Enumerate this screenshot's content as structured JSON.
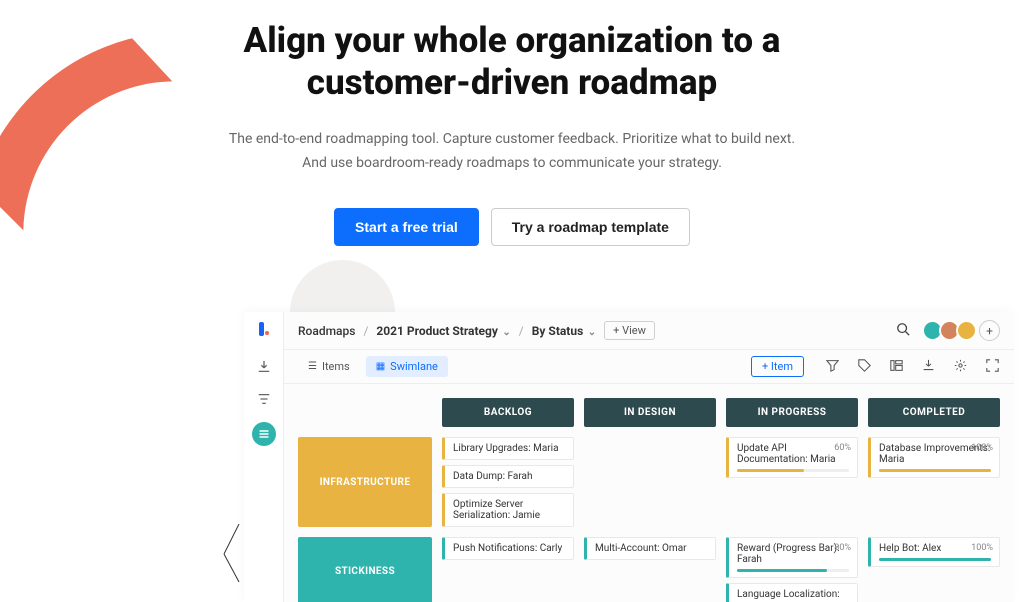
{
  "hero": {
    "title_line1": "Align your whole organization to a",
    "title_line2": "customer-driven roadmap",
    "subtitle_line1": "The end-to-end roadmapping tool. Capture customer feedback. Prioritize what to build next.",
    "subtitle_line2": "And use boardroom-ready roadmaps to communicate your strategy.",
    "cta_primary": "Start a free trial",
    "cta_secondary": "Try a roadmap template"
  },
  "app": {
    "breadcrumbs": {
      "root": "Roadmaps",
      "item": "2021 Product Strategy",
      "view": "By Status"
    },
    "add_view": "+ View",
    "view_tabs": {
      "items": "Items",
      "swimlane": "Swimlane"
    },
    "add_item": "+ Item",
    "columns": [
      "BACKLOG",
      "IN DESIGN",
      "IN PROGRESS",
      "COMPLETED"
    ],
    "rows": [
      {
        "name": "INFRASTRUCTURE",
        "color": "#e8b341",
        "cells": [
          [
            {
              "text": "Library Upgrades: Maria"
            },
            {
              "text": "Data Dump: Farah"
            },
            {
              "text": "Optimize Server Serialization: Jamie"
            }
          ],
          [],
          [
            {
              "text": "Update API Documentation: Maria",
              "progress": 60,
              "pct": "60%"
            }
          ],
          [
            {
              "text": "Database Improvements: Maria",
              "progress": 100,
              "pct": "100%"
            }
          ]
        ]
      },
      {
        "name": "STICKINESS",
        "color": "#2fb3ad",
        "cells": [
          [
            {
              "text": "Push Notifications: Carly"
            }
          ],
          [
            {
              "text": "Multi-Account: Omar"
            }
          ],
          [
            {
              "text": "Reward (Progress Bar): Farah",
              "progress": 80,
              "pct": "80%"
            },
            {
              "text": "Language Localization:"
            }
          ],
          [
            {
              "text": "Help Bot: Alex",
              "progress": 100,
              "pct": "100%"
            }
          ]
        ]
      }
    ]
  }
}
